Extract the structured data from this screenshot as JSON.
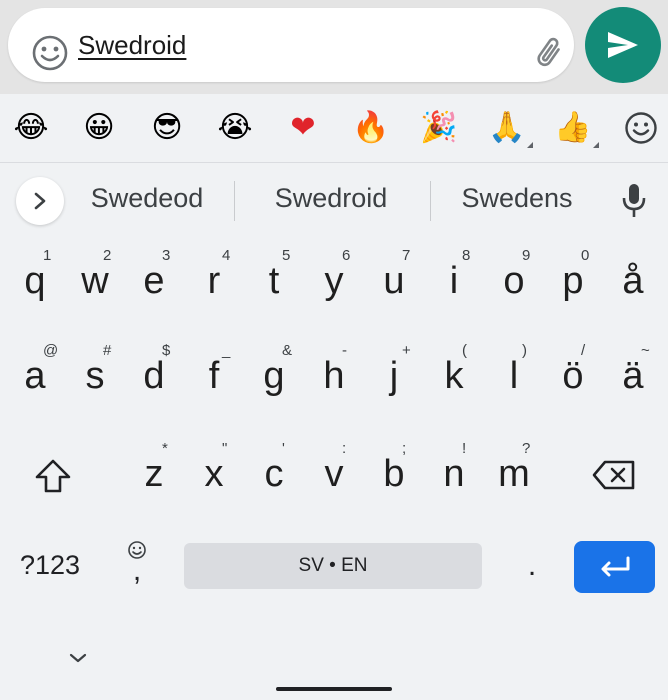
{
  "compose": {
    "message_text": "Swedroid",
    "icons": {
      "smiley": "smiley-icon",
      "attach": "paperclip-icon",
      "send": "send-icon"
    },
    "send_color": "#138b78"
  },
  "emoji_row": {
    "emojis": [
      "😂",
      "😀",
      "😎",
      "😭",
      "❤",
      "🔥",
      "🎉",
      "🙏",
      "👍"
    ],
    "last_icon": "smiley-icon"
  },
  "suggestions": {
    "items": [
      "Swedeod",
      "Swedroid",
      "Swedens"
    ],
    "expand_icon": "chevron-right-icon",
    "mic_icon": "microphone-icon"
  },
  "keyboard": {
    "row1": [
      {
        "key": "q",
        "hint": "1"
      },
      {
        "key": "w",
        "hint": "2"
      },
      {
        "key": "e",
        "hint": "3"
      },
      {
        "key": "r",
        "hint": "4"
      },
      {
        "key": "t",
        "hint": "5"
      },
      {
        "key": "y",
        "hint": "6"
      },
      {
        "key": "u",
        "hint": "7"
      },
      {
        "key": "i",
        "hint": "8"
      },
      {
        "key": "o",
        "hint": "9"
      },
      {
        "key": "p",
        "hint": "0"
      },
      {
        "key": "å",
        "hint": ""
      }
    ],
    "row2": [
      {
        "key": "a",
        "hint": "@"
      },
      {
        "key": "s",
        "hint": "#"
      },
      {
        "key": "d",
        "hint": "$"
      },
      {
        "key": "f",
        "hint": "_"
      },
      {
        "key": "g",
        "hint": "&"
      },
      {
        "key": "h",
        "hint": "-"
      },
      {
        "key": "j",
        "hint": "+"
      },
      {
        "key": "k",
        "hint": "("
      },
      {
        "key": "l",
        "hint": ")"
      },
      {
        "key": "ö",
        "hint": "/"
      },
      {
        "key": "ä",
        "hint": "~"
      }
    ],
    "row3": [
      {
        "key": "z",
        "hint": "*"
      },
      {
        "key": "x",
        "hint": "\""
      },
      {
        "key": "c",
        "hint": "'"
      },
      {
        "key": "v",
        "hint": ":"
      },
      {
        "key": "b",
        "hint": ";"
      },
      {
        "key": "n",
        "hint": "!"
      },
      {
        "key": "m",
        "hint": "?"
      }
    ],
    "shift_icon": "shift-icon",
    "backspace_icon": "backspace-icon",
    "symbols_label": "?123",
    "comma_label": ",",
    "comma_hint_icon": "smiley-icon",
    "space_label": "SV • EN",
    "period_label": ".",
    "enter_icon": "enter-icon",
    "enter_color": "#1a73e8",
    "hide_icon": "chevron-down-icon"
  }
}
